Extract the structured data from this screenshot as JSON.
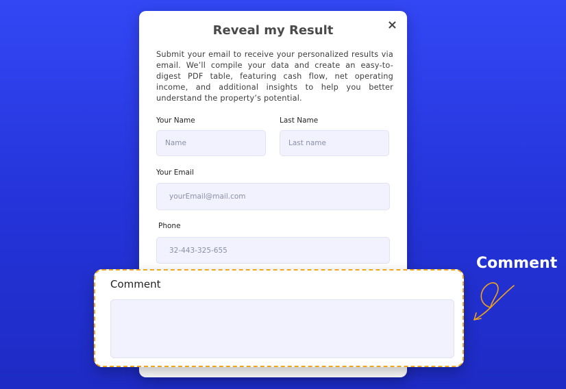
{
  "modal": {
    "title": "Reveal my Result",
    "close_symbol": "×",
    "description": "Submit your email to receive your personalized results via email. We’ll compile your data and create an easy-to-digest PDF table, featuring cash flow, net operating income, and additional insights to help you better understand the property’s potential.",
    "first_name": {
      "label": "Your Name",
      "placeholder": "Name"
    },
    "last_name": {
      "label": "Last Name",
      "placeholder": "Last name"
    },
    "email": {
      "label": "Your Email",
      "placeholder": "yourEmail@mail.com"
    },
    "phone": {
      "label": "Phone",
      "placeholder": "32-443-325-655"
    }
  },
  "comment_field": {
    "label": "Comment",
    "value": ""
  },
  "callout": {
    "text": "Comment",
    "color": "#ffffff",
    "arrow_color": "#f2a51a",
    "arrow_icon": "curly-arrow-icon"
  },
  "colors": {
    "background": "#2a3be6",
    "highlight_border": "#f2a51a",
    "input_bg": "#f1f2fd"
  }
}
